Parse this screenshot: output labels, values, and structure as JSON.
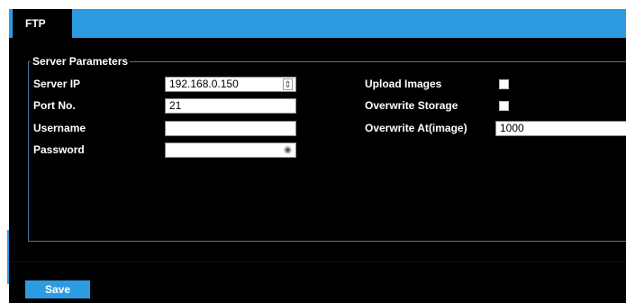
{
  "tab": {
    "label": "FTP"
  },
  "server_parameters": {
    "legend": "Server Parameters",
    "fields": {
      "server_ip": {
        "label": "Server IP",
        "value": "192.168.0.150"
      },
      "port": {
        "label": "Port No.",
        "value": "21"
      },
      "username": {
        "label": "Username",
        "value": ""
      },
      "password": {
        "label": "Password",
        "value": ""
      },
      "upload_images": {
        "label": "Upload Images",
        "checked": false
      },
      "overwrite_storage": {
        "label": "Overwrite Storage",
        "checked": false
      },
      "overwrite_at": {
        "label": "Overwrite At(image)",
        "value": "1000"
      }
    }
  },
  "actions": {
    "save_label": "Save"
  },
  "colors": {
    "accent": "#2d9be0",
    "background": "#000000",
    "fieldset_border": "#3a7ab0"
  }
}
